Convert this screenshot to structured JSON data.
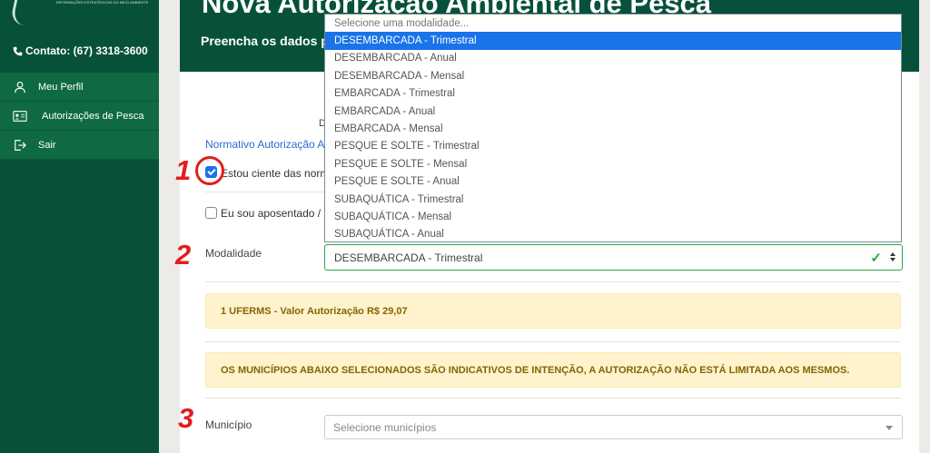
{
  "sidebar": {
    "logo_text": "INFORMAÇÕES ESTRATÉGICAS DO MEIO AMBIENTE",
    "contact": "Contato: (67) 3318-3600",
    "items": [
      {
        "label": "Meu Perfil",
        "icon": "user-icon"
      },
      {
        "label": "Autorizações de Pesca",
        "icon": "id-card-icon"
      },
      {
        "label": "Sair",
        "icon": "sign-out-icon"
      }
    ]
  },
  "header": {
    "title": "Nova Autorização Ambiental de Pesca",
    "subtitle": "Preencha os dados p"
  },
  "form": {
    "doc_letter": "D",
    "normativo_link": "Normativo Autorização A",
    "checkbox_ciente": {
      "label": "Estou ciente das norm",
      "checked": true
    },
    "checkbox_aposentado": {
      "label": "Eu sou aposentado / i",
      "checked": false
    },
    "modalidade_label": "Modalidade",
    "modalidade_value": "DESEMBARCADA - Trimestral",
    "valor_alert": "1 UFERMS - Valor Autorização R$ 29,07",
    "municipios_alert": "OS MUNICÍPIOS ABAIXO SELECIONADOS SÃO INDICATIVOS DE INTENÇÃO, A AUTORIZAÇÃO NÃO ESTÁ LIMITADA AOS MESMOS.",
    "municipio_label": "Município",
    "municipio_placeholder": "Selecione municípios"
  },
  "dropdown": {
    "options": [
      "Selecione uma modalidade...",
      "DESEMBARCADA - Trimestral",
      "DESEMBARCADA - Anual",
      "DESEMBARCADA - Mensal",
      "EMBARCADA - Trimestral",
      "EMBARCADA - Anual",
      "EMBARCADA - Mensal",
      "PESQUE E SOLTE - Trimestral",
      "PESQUE E SOLTE - Mensal",
      "PESQUE E SOLTE - Anual",
      "SUBAQUÁTICA - Trimestral",
      "SUBAQUÁTICA - Mensal",
      "SUBAQUÁTICA - Anual"
    ],
    "selected_index": 1
  },
  "annotations": {
    "step1": "1",
    "step2": "2",
    "step3": "3"
  },
  "colors": {
    "sidebar": "#07513a",
    "menu_item": "#0f6a43",
    "accent": "#1a73e8",
    "annotation": "#e01e1e",
    "alert_bg": "#fff3cd"
  }
}
